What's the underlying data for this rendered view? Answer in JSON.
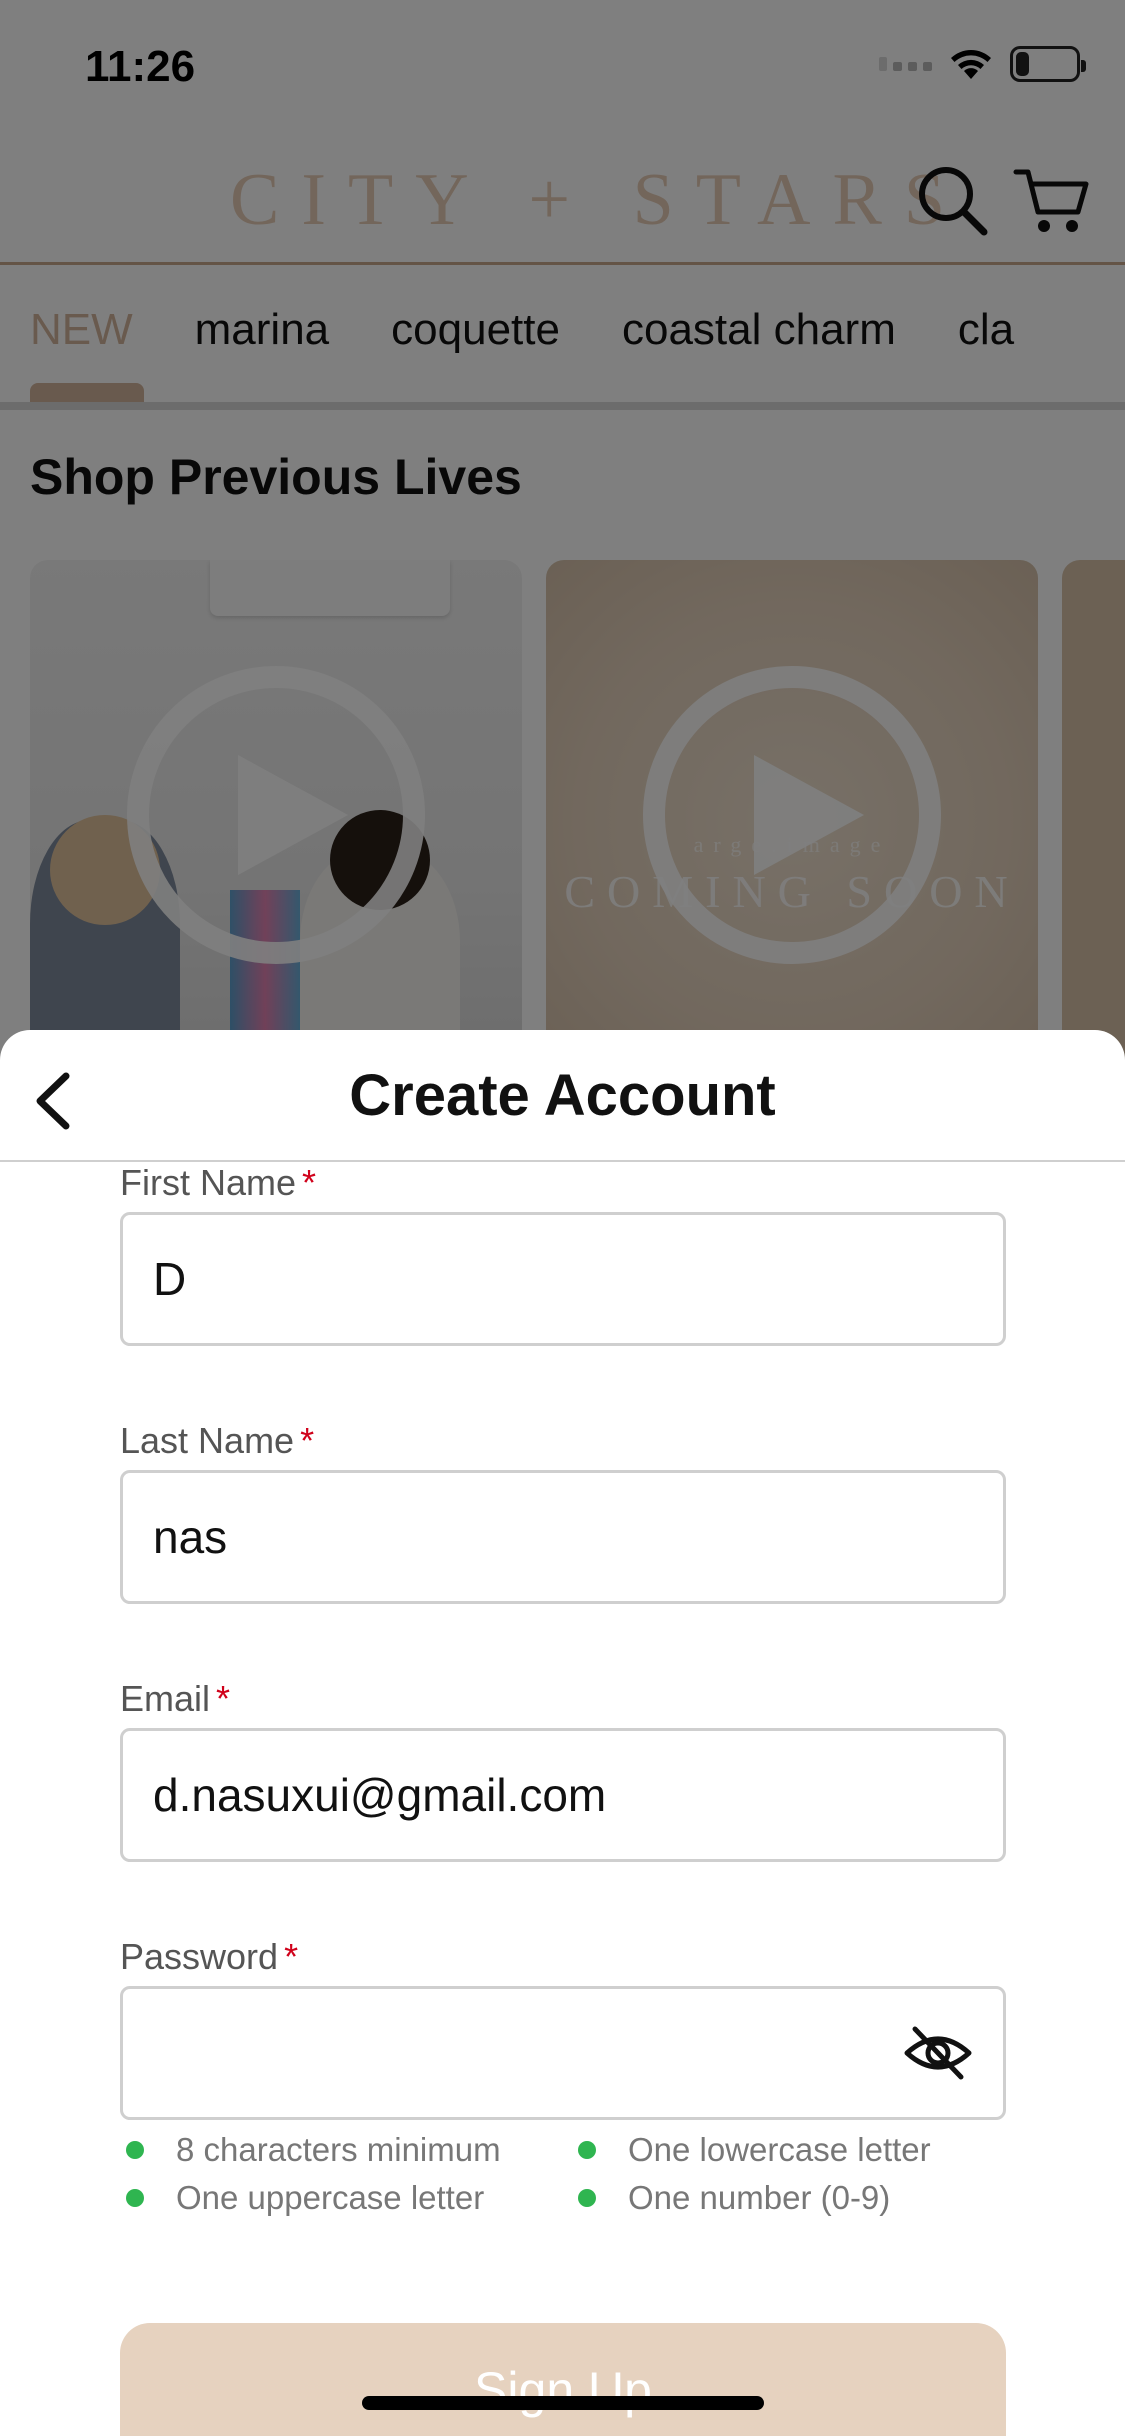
{
  "status_bar": {
    "time": "11:26",
    "battery": "22",
    "battery_level": 0.22
  },
  "app_header": {
    "brand": "CITY + STARS",
    "search_icon": "search-icon",
    "cart_icon": "cart-icon"
  },
  "tabs": {
    "items": [
      {
        "label": "NEW",
        "active": true
      },
      {
        "label": "marina",
        "active": false
      },
      {
        "label": "coquette",
        "active": false
      },
      {
        "label": "coastal charm",
        "active": false
      },
      {
        "label": "cla",
        "active": false
      }
    ]
  },
  "section": {
    "title": "Shop Previous Lives",
    "cards": [
      {
        "icon": "play-icon",
        "overlay_text": ""
      },
      {
        "icon": "play-icon",
        "overlay_text": "COMING SOON",
        "overlay_subtext": "arge.image"
      }
    ]
  },
  "sheet": {
    "title": "Create Account",
    "back_icon": "chevron-left-icon",
    "fields": {
      "first_name": {
        "label": "First Name",
        "required_mark": "*",
        "value": "D"
      },
      "last_name": {
        "label": "Last Name",
        "required_mark": "*",
        "value": "nas"
      },
      "email": {
        "label": "Email",
        "required_mark": "*",
        "value": "d.nasuxui@gmail.com"
      },
      "password": {
        "label": "Password",
        "required_mark": "*",
        "value": "",
        "toggle_icon": "eye-slash-icon"
      }
    },
    "password_rules": [
      {
        "text": "8 characters minimum",
        "met": true
      },
      {
        "text": "One lowercase letter",
        "met": true
      },
      {
        "text": "One uppercase letter",
        "met": true
      },
      {
        "text": "One number (0-9)",
        "met": true
      }
    ],
    "signup_label": "Sign Up"
  },
  "colors": {
    "accent": "#d3b59c",
    "signup_button": "#e6d2bf",
    "required": "#d0021b",
    "rule_met": "#2fb550"
  }
}
